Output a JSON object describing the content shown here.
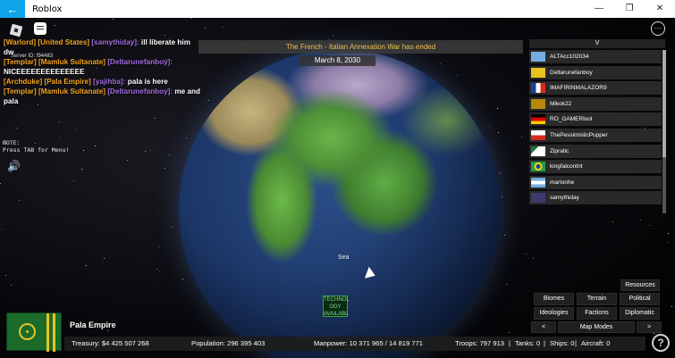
{
  "window": {
    "title": "Roblox",
    "back_glyph": "←",
    "minimize_glyph": "—",
    "maximize_glyph": "❐",
    "close_glyph": "✕"
  },
  "chat": {
    "server_id": "Server ID: f94483",
    "lines": [
      {
        "tag": "[Warlord] [United States]",
        "name": "[samythiday]:",
        "text": " ill liberate him dw"
      },
      {
        "tag": "[Templar] [Mamluk Sultanate]",
        "name": "[Deltarunefanboy]:",
        "text": " NICEEEEEEEEEEEEEE"
      },
      {
        "tag": "[Archduke] [Pala Empire]",
        "name": "[yajihba]:",
        "text": " pala is here"
      },
      {
        "tag": "[Templar] [Mamluk Sultanate]",
        "name": "[Deltarunefanboy]:",
        "text": " me and pala"
      }
    ]
  },
  "note": {
    "line1": "NOTE:",
    "line2": "Press TAB for Menu!"
  },
  "banner": {
    "event": "The French - Italian Annexation War has ended",
    "date": "March 8, 2030"
  },
  "map": {
    "sea_label": "Sea",
    "tech_badge": "TECHNOL OGY AVAILABL"
  },
  "player_list": {
    "header": "V",
    "players": [
      {
        "name": "ALTAcc102034",
        "flag": "sky-blue"
      },
      {
        "name": "Deltarunefanboy",
        "flag": "mamluk-yellow"
      },
      {
        "name": "IMAFIRINMALAZOR9",
        "flag": "france"
      },
      {
        "name": "Mikok22",
        "flag": "gold-shield"
      },
      {
        "name": "RO_GAMERlool",
        "flag": "germany"
      },
      {
        "name": "ThePessimisticPupper",
        "flag": "red-white"
      },
      {
        "name": "Zipratic",
        "flag": "emblem-white"
      },
      {
        "name": "kingfalcontnt",
        "flag": "brazil"
      },
      {
        "name": "marlonhe",
        "flag": "argentina"
      },
      {
        "name": "samythiday",
        "flag": "usa"
      }
    ]
  },
  "panel": {
    "resources": "Resources",
    "biomes": "Biomes",
    "terrain": "Terrain",
    "political": "Political",
    "ideologies": "Ideologies",
    "factions": "Factions",
    "diplomatic": "Diplomatic",
    "prev": "<",
    "map_modes": "Map Modes",
    "next": ">"
  },
  "nation": {
    "name": "Pala Empire",
    "treasury": "Treasury:  $4 425 507 268",
    "population": "Population: 296 395 403",
    "manpower": "Manpower:  10 371 965  /  14 819 771",
    "troops": "Troops: 797 913",
    "tanks": "Tanks: 0",
    "ships": "Ships: 0",
    "aircraft": "Aircraft: 0",
    "sep": "|"
  },
  "help_label": "?",
  "speaker_glyph": "🔊",
  "menu_glyph": "···",
  "colors": {
    "title_accent": "#0ea5e9",
    "chat_tag": "#f5a623",
    "chat_name": "#a26de0",
    "banner_text": "#f2c14e",
    "pala_green": "#1a6b2a",
    "pala_gold": "#e8c21d"
  }
}
